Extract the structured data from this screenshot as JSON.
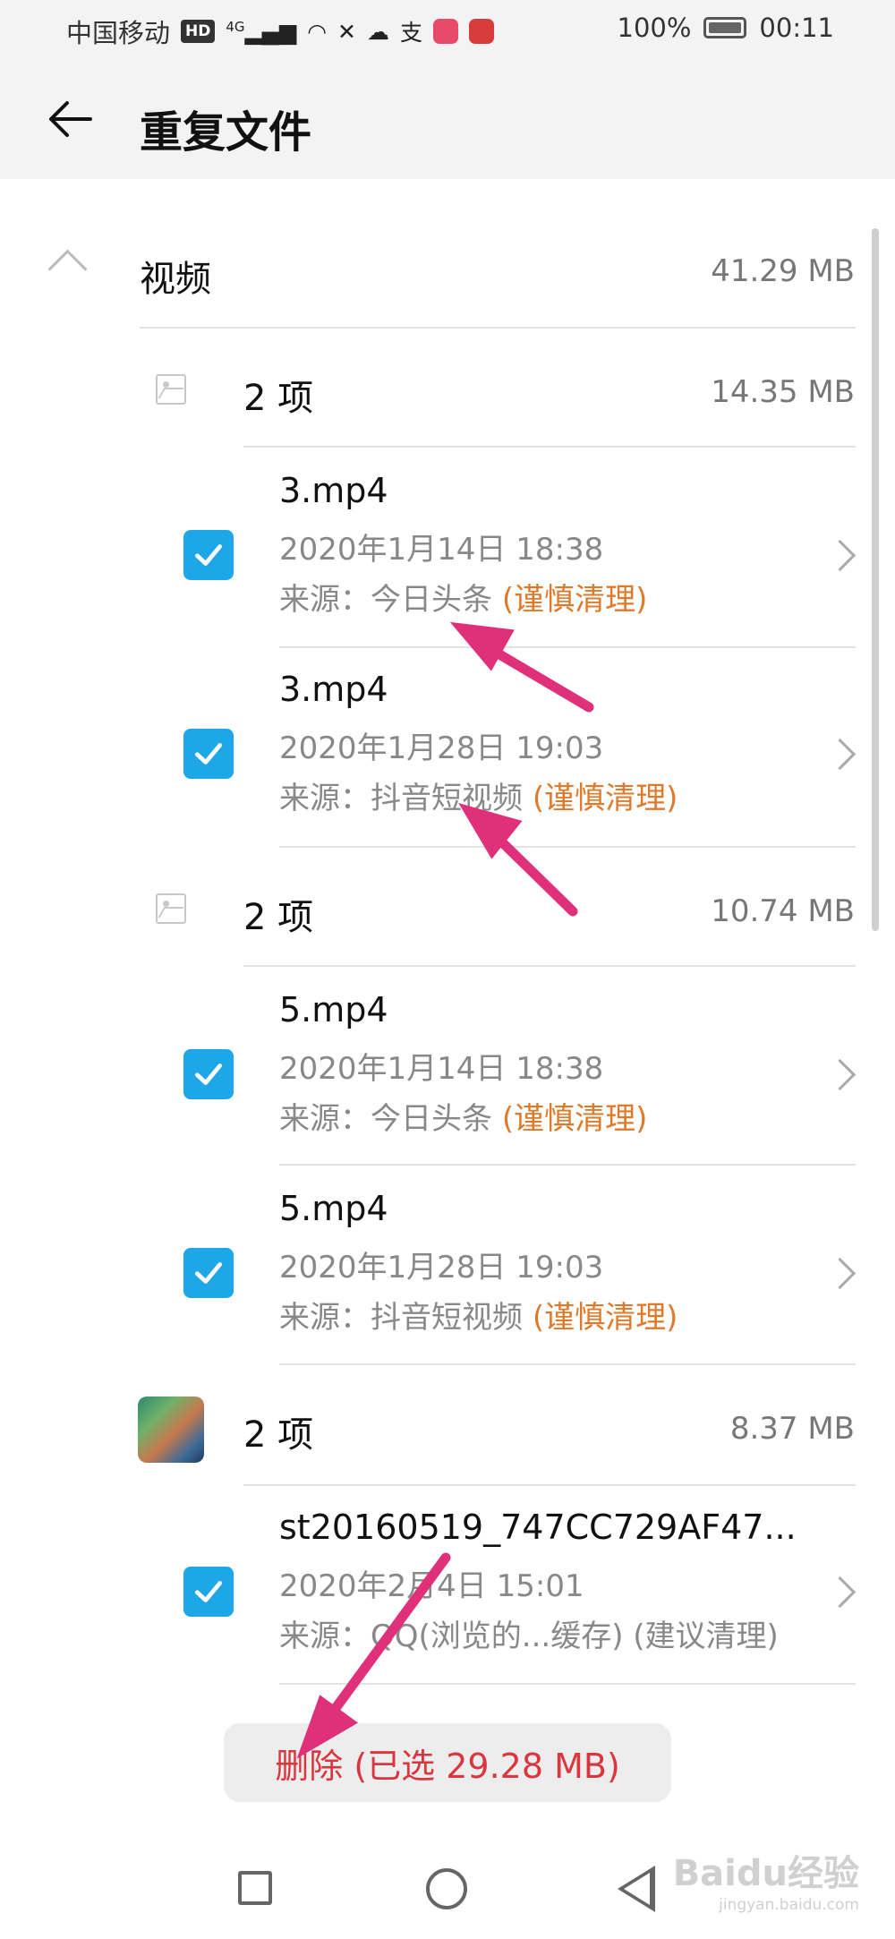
{
  "status_bar": {
    "carrier": "中国移动",
    "hd": "HD",
    "network": "4G",
    "battery": "100%",
    "time": "00:11"
  },
  "header": {
    "title": "重复文件"
  },
  "category": {
    "label": "视频",
    "size": "41.29 MB"
  },
  "groups": [
    {
      "label": "2 项",
      "size": "14.35 MB",
      "files": [
        {
          "name": "3.mp4",
          "date": "2020年1月14日 18:38",
          "source": "来源：今日头条",
          "tag": "(谨慎清理)"
        },
        {
          "name": "3.mp4",
          "date": "2020年1月28日 19:03",
          "source": "来源：抖音短视频",
          "tag": "(谨慎清理)"
        }
      ]
    },
    {
      "label": "2 项",
      "size": "10.74 MB",
      "files": [
        {
          "name": "5.mp4",
          "date": "2020年1月14日 18:38",
          "source": "来源：今日头条",
          "tag": "(谨慎清理)"
        },
        {
          "name": "5.mp4",
          "date": "2020年1月28日 19:03",
          "source": "来源：抖音短视频",
          "tag": "(谨慎清理)"
        }
      ]
    },
    {
      "label": "2 项",
      "size": "8.37 MB",
      "files": [
        {
          "name": "st20160519_747CC729AF47...",
          "date": "2020年2月4日 15:01",
          "source": "来源：QQ(浏览的...缓存) (建议清理)",
          "tag": ""
        }
      ]
    }
  ],
  "delete_button": {
    "label": "删除 (已选 29.28 MB)"
  },
  "watermark": {
    "brand": "Baidu经验",
    "url": "jingyan.baidu.com"
  },
  "colors": {
    "accent": "#1ea7e8",
    "warning": "#e07a2b",
    "danger": "#d9363e",
    "annotation": "#e0307a"
  },
  "icons": [
    "back-arrow-icon",
    "chevron-up-icon",
    "image-placeholder-icon",
    "checkbox-checked-icon",
    "chevron-right-icon",
    "nav-recents-icon",
    "nav-home-icon",
    "nav-back-icon"
  ]
}
